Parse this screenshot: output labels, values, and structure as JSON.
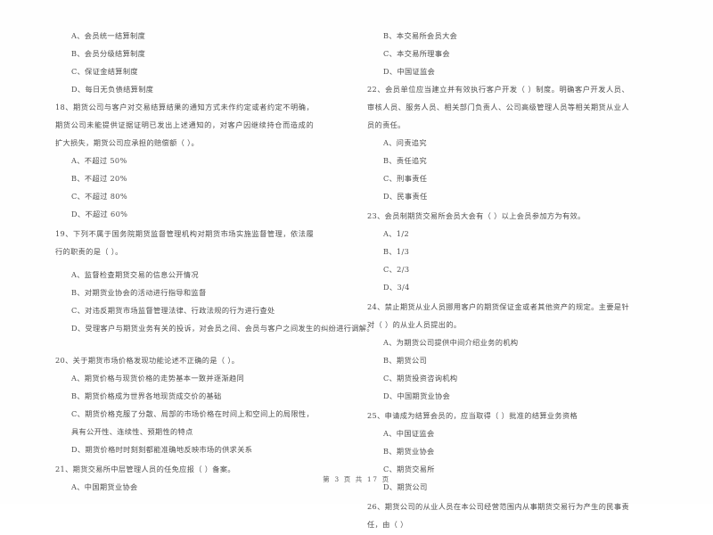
{
  "document": {
    "type": "exam-paper",
    "language": "zh-CN",
    "footer": "第 3 页 共 17 页",
    "page_number": "3",
    "total_pages": "17",
    "text_color": "#4d4d4d",
    "background_color": "#fefefe"
  },
  "left_column": {
    "continued_options": [
      "A、会员统一结算制度",
      "B、会员分级结算制度",
      "C、保证金结算制度",
      "D、每日无负债结算制度"
    ],
    "questions": [
      {
        "number": "18",
        "stem": "18、期货公司与客户对交易结算结果的通知方式未作约定或者约定不明确，期货公司未能提供证据证明已发出上述通知的，对客户因继续持仓而造成的扩大损失，期货公司应承担的赔偿额（    ）。",
        "options": [
          "A、不超过 50%",
          "B、不超过 20%",
          "C、不超过 80%",
          "D、不超过 60%"
        ]
      },
      {
        "number": "19",
        "stem": "19、下列不属于国务院期货监督管理机构对期货市场实施监督管理，依法履行的职责的是（    ）。",
        "options": [
          "A、监督检查期货交易的信息公开情况",
          "B、对期货业协会的活动进行指导和监督",
          "C、对违反期货市场监督管理法律、行政法规的行为进行查处",
          "D、受理客户与期货业务有关的投诉，对会员之间、会员与客户之间发生的纠纷进行调解。"
        ]
      },
      {
        "number": "20",
        "stem": "20、关于期货市场价格发现功能论述不正确的是（    ）。",
        "options": [
          "A、期货价格与现货价格的走势基本一致并逐渐趋同",
          "B、期货价格成为世界各地现货成交价的基础",
          "C、期货价格克服了分散、局部的市场价格在时间上和空间上的局限性，具有公开性、连续性、预期性的特点",
          "D、期货价格时时刻刻都能准确地反映市场的供求关系"
        ]
      },
      {
        "number": "21",
        "stem": "21、期货交易所中层管理人员的任免应报（    ）备案。",
        "options": [
          "A、中国期货业协会"
        ]
      }
    ]
  },
  "right_column": {
    "continued_options": [
      "B、本交易所会员大会",
      "C、本交易所理事会",
      "D、中国证监会"
    ],
    "questions": [
      {
        "number": "22",
        "stem": "22、会员单位应当建立并有效执行客户开发（    ）制度。明确客户开发人员、审核人员、服务人员、相关部门负责人、公司高级管理人员等相关期货从业人员的责任。",
        "options": [
          "A、问责追究",
          "B、责任追究",
          "C、刑事责任",
          "D、民事责任"
        ]
      },
      {
        "number": "23",
        "stem": "23、会员制期货交易所会员大会有（    ）以上会员参加方为有效。",
        "options": [
          "A、1/2",
          "B、1/3",
          "C、2/3",
          "D、3/4"
        ]
      },
      {
        "number": "24",
        "stem": "24、禁止期货从业人员挪用客户的期货保证金或者其他资产的规定。主要是针对（    ）的从业人员提出的。",
        "options": [
          "A、为期货公司提供中间介绍业务的机构",
          "B、期货公司",
          "C、期货投资咨询机构",
          "D、中国期货业协会"
        ]
      },
      {
        "number": "25",
        "stem": "25、申请成为结算会员的，应当取得（    ）批准的结算业务资格",
        "options": [
          "A、中国证监会",
          "B、期货业协会",
          "C、期货交易所",
          "D、期货公司"
        ]
      },
      {
        "number": "26",
        "stem": "26、期货公司的从业人员在本公司经营范围内从事期货交易行为产生的民事责任，由（    ）",
        "options": []
      }
    ]
  }
}
